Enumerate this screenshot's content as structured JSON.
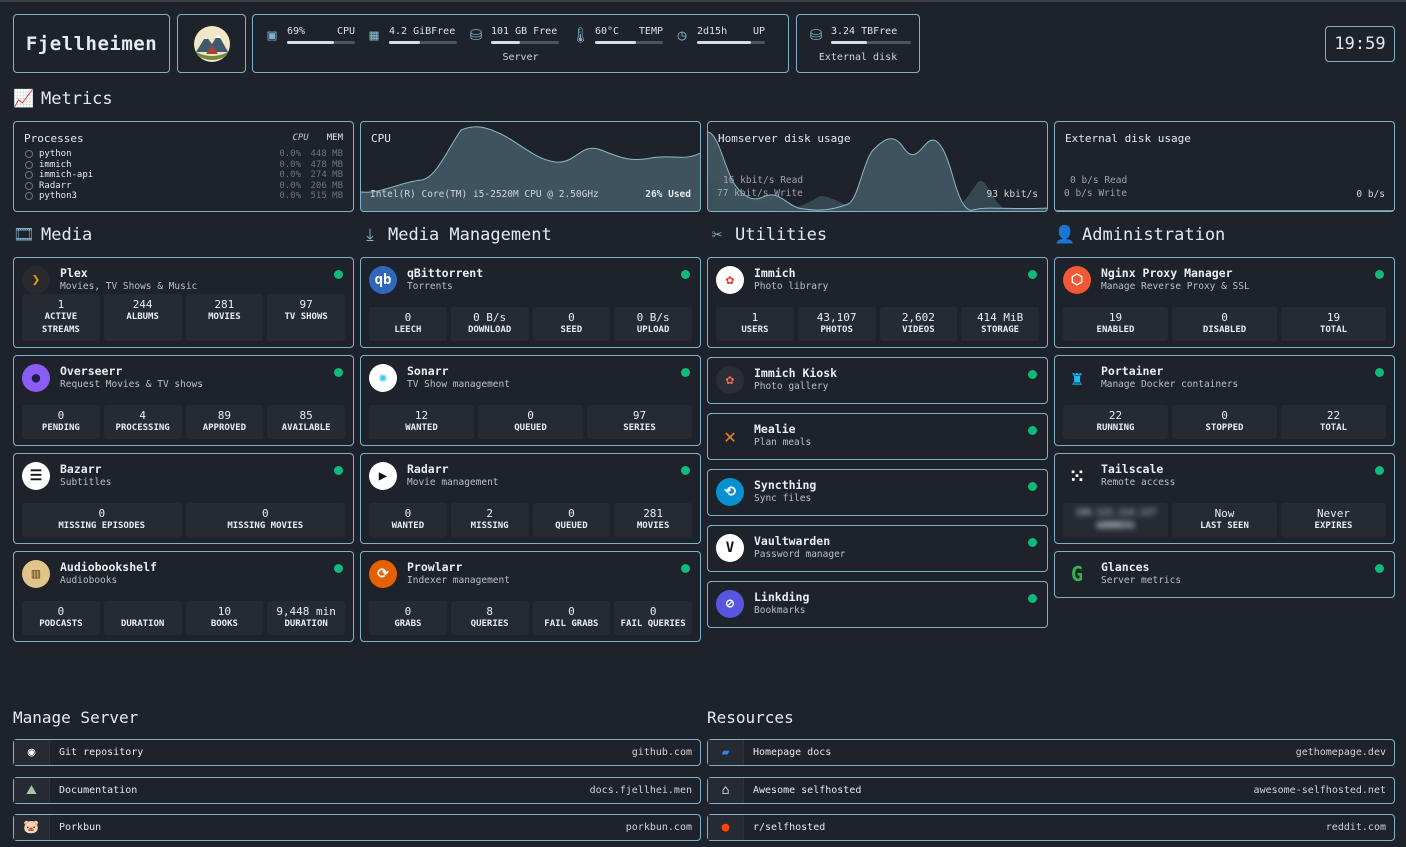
{
  "header": {
    "brand": "Fjellheimen",
    "server": {
      "label": "Server",
      "cpu": {
        "value": "69%",
        "label": "CPU",
        "fraction": 0.69,
        "icon": "cpu-icon"
      },
      "memory": {
        "value": "4.2 GiBFree",
        "label": "",
        "fraction": 0.45,
        "icon": "memory-icon"
      },
      "disk": {
        "value": "101 GB Free",
        "label": "",
        "fraction": 0.42,
        "icon": "disk-icon"
      },
      "temp": {
        "value": "60°C",
        "label": "TEMP",
        "fraction": 0.6,
        "icon": "thermometer-icon"
      },
      "uptime": {
        "value": "2d15h",
        "label": "UP",
        "fraction": 0.8,
        "icon": "clock-icon"
      }
    },
    "external": {
      "label": "External disk",
      "value": "3.24 TBFree",
      "fraction": 0.45,
      "icon": "disk-icon"
    },
    "clock": "19:59"
  },
  "sections": {
    "metrics": "Metrics",
    "media": "Media",
    "media_management": "Media Management",
    "utilities": "Utilities",
    "administration": "Administration"
  },
  "metrics": {
    "processes": {
      "title": "Processes",
      "cpu_header": "CPU",
      "mem_header": "MEM",
      "rows": [
        {
          "name": "python",
          "cpu": "0.0%",
          "mem": "448 MB"
        },
        {
          "name": "immich",
          "cpu": "0.0%",
          "mem": "478 MB"
        },
        {
          "name": "immich-api",
          "cpu": "0.0%",
          "mem": "274 MB"
        },
        {
          "name": "Radarr",
          "cpu": "0.0%",
          "mem": "206 MB"
        },
        {
          "name": "python3",
          "cpu": "0.0%",
          "mem": "515 MB"
        }
      ]
    },
    "cpu": {
      "title": "CPU",
      "model": "Intel(R) Core(TM) i5-2520M CPU @ 2.50GHz",
      "used": "26% Used"
    },
    "home_disk": {
      "title": "Homserver disk usage",
      "read": "16 kbit/s Read",
      "write": "77 kbit/s Write",
      "total": "93 kbit/s"
    },
    "ext_disk": {
      "title": "External disk usage",
      "read": "0 b/s Read",
      "write": "0 b/s Write",
      "total": "0 b/s"
    }
  },
  "media": [
    {
      "name": "Plex",
      "desc": "Movies, TV Shows & Music",
      "icon": "plex-icon",
      "stats": [
        {
          "v": "1",
          "l": "ACTIVE STREAMS"
        },
        {
          "v": "244",
          "l": "ALBUMS"
        },
        {
          "v": "281",
          "l": "MOVIES"
        },
        {
          "v": "97",
          "l": "TV SHOWS"
        }
      ]
    },
    {
      "name": "Overseerr",
      "desc": "Request Movies & TV shows",
      "icon": "overseerr-icon",
      "stats": [
        {
          "v": "0",
          "l": "PENDING"
        },
        {
          "v": "4",
          "l": "PROCESSING"
        },
        {
          "v": "89",
          "l": "APPROVED"
        },
        {
          "v": "85",
          "l": "AVAILABLE"
        }
      ]
    },
    {
      "name": "Bazarr",
      "desc": "Subtitles",
      "icon": "bazarr-icon",
      "stats": [
        {
          "v": "0",
          "l": "MISSING EPISODES"
        },
        {
          "v": "0",
          "l": "MISSING MOVIES"
        }
      ]
    },
    {
      "name": "Audiobookshelf",
      "desc": "Audiobooks",
      "icon": "audiobookshelf-icon",
      "stats": [
        {
          "v": "0",
          "l": "PODCASTS"
        },
        {
          "v": "",
          "l": "DURATION"
        },
        {
          "v": "10",
          "l": "BOOKS"
        },
        {
          "v": "9,448 min",
          "l": "DURATION"
        }
      ]
    }
  ],
  "media_management": [
    {
      "name": "qBittorrent",
      "desc": "Torrents",
      "icon": "qbittorrent-icon",
      "stats": [
        {
          "v": "0",
          "l": "LEECH"
        },
        {
          "v": "0 B/s",
          "l": "DOWNLOAD"
        },
        {
          "v": "0",
          "l": "SEED"
        },
        {
          "v": "0 B/s",
          "l": "UPLOAD"
        }
      ]
    },
    {
      "name": "Sonarr",
      "desc": "TV Show management",
      "icon": "sonarr-icon",
      "stats": [
        {
          "v": "12",
          "l": "WANTED"
        },
        {
          "v": "0",
          "l": "QUEUED"
        },
        {
          "v": "97",
          "l": "SERIES"
        }
      ]
    },
    {
      "name": "Radarr",
      "desc": "Movie management",
      "icon": "radarr-icon",
      "stats": [
        {
          "v": "0",
          "l": "WANTED"
        },
        {
          "v": "2",
          "l": "MISSING"
        },
        {
          "v": "0",
          "l": "QUEUED"
        },
        {
          "v": "281",
          "l": "MOVIES"
        }
      ]
    },
    {
      "name": "Prowlarr",
      "desc": "Indexer management",
      "icon": "prowlarr-icon",
      "stats": [
        {
          "v": "0",
          "l": "GRABS"
        },
        {
          "v": "8",
          "l": "QUERIES"
        },
        {
          "v": "0",
          "l": "FAIL GRABS"
        },
        {
          "v": "0",
          "l": "FAIL QUERIES"
        }
      ]
    }
  ],
  "utilities": [
    {
      "name": "Immich",
      "desc": "Photo library",
      "icon": "immich-icon",
      "stats": [
        {
          "v": "1",
          "l": "USERS"
        },
        {
          "v": "43,107",
          "l": "PHOTOS"
        },
        {
          "v": "2,602",
          "l": "VIDEOS"
        },
        {
          "v": "414 MiB",
          "l": "STORAGE"
        }
      ]
    },
    {
      "name": "Immich Kiosk",
      "desc": "Photo gallery",
      "icon": "immich-kiosk-icon"
    },
    {
      "name": "Mealie",
      "desc": "Plan meals",
      "icon": "mealie-icon"
    },
    {
      "name": "Syncthing",
      "desc": "Sync files",
      "icon": "syncthing-icon"
    },
    {
      "name": "Vaultwarden",
      "desc": "Password manager",
      "icon": "vaultwarden-icon"
    },
    {
      "name": "Linkding",
      "desc": "Bookmarks",
      "icon": "linkding-icon"
    }
  ],
  "administration": [
    {
      "name": "Nginx Proxy Manager",
      "desc": "Manage Reverse Proxy & SSL",
      "icon": "nginx-proxy-manager-icon",
      "stats": [
        {
          "v": "19",
          "l": "ENABLED"
        },
        {
          "v": "0",
          "l": "DISABLED"
        },
        {
          "v": "19",
          "l": "TOTAL"
        }
      ]
    },
    {
      "name": "Portainer",
      "desc": "Manage Docker containers",
      "icon": "portainer-icon",
      "stats": [
        {
          "v": "22",
          "l": "RUNNING"
        },
        {
          "v": "0",
          "l": "STOPPED"
        },
        {
          "v": "22",
          "l": "TOTAL"
        }
      ]
    },
    {
      "name": "Tailscale",
      "desc": "Remote access",
      "icon": "tailscale-icon",
      "stats": [
        {
          "v": "100.123.114.127",
          "l": "ADDRESS"
        },
        {
          "v": "Now",
          "l": "LAST SEEN"
        },
        {
          "v": "Never",
          "l": "EXPIRES"
        }
      ]
    },
    {
      "name": "Glances",
      "desc": "Server metrics",
      "icon": "glances-icon"
    }
  ],
  "bookmarks": {
    "manage_title": "Manage Server",
    "resources_title": "Resources",
    "manage": [
      {
        "name": "Git repository",
        "href": "github.com",
        "icon": "github-icon"
      },
      {
        "name": "Documentation",
        "href": "docs.fjellhei.men",
        "icon": "documentation-icon"
      },
      {
        "name": "Porkbun",
        "href": "porkbun.com",
        "icon": "porkbun-icon"
      }
    ],
    "resources": [
      {
        "name": "Homepage docs",
        "href": "gethomepage.dev",
        "icon": "homepage-icon"
      },
      {
        "name": "Awesome selfhosted",
        "href": "awesome-selfhosted.net",
        "icon": "awesome-selfhosted-icon"
      },
      {
        "name": "r/selfhosted",
        "href": "reddit.com",
        "icon": "reddit-icon"
      }
    ]
  }
}
